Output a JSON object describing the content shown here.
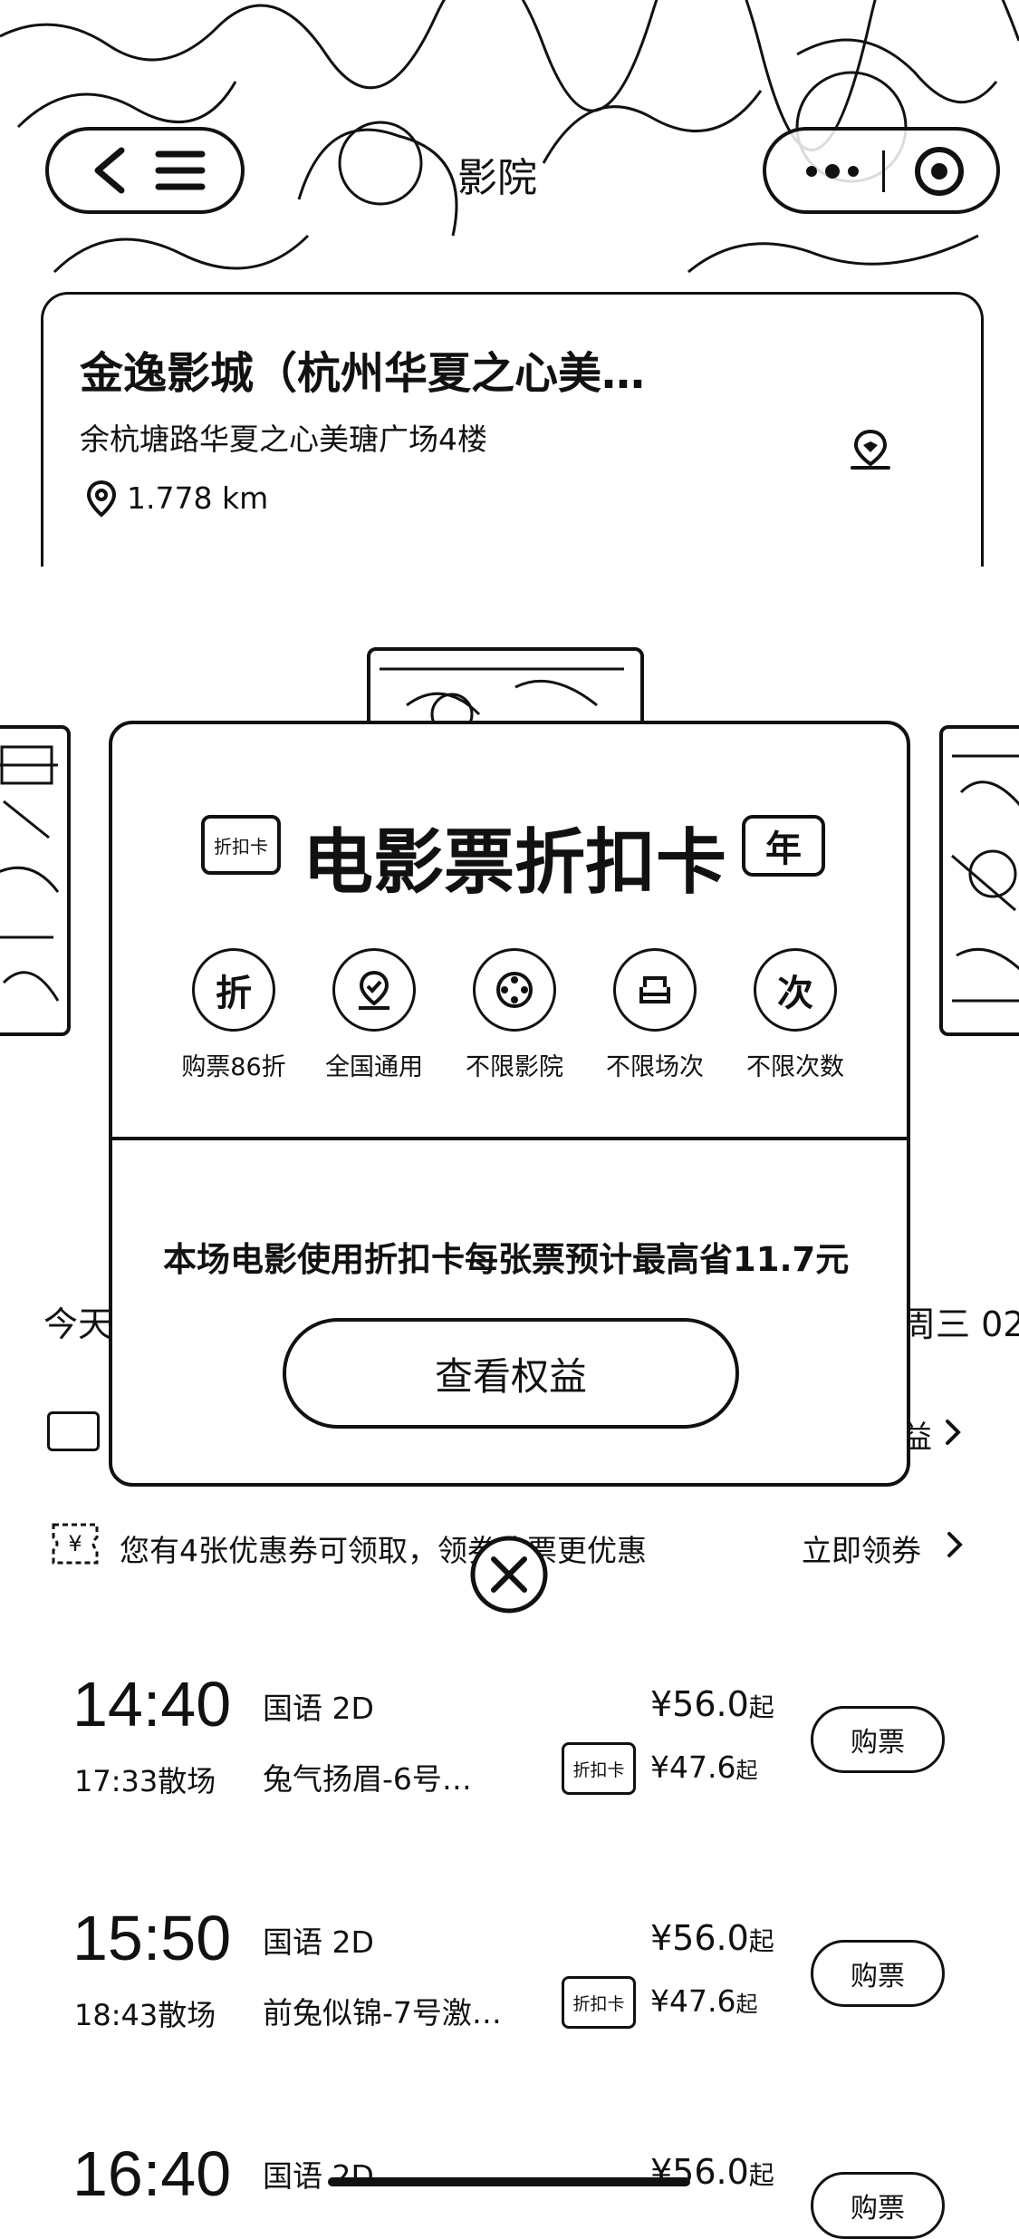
{
  "header": {
    "title": "影院"
  },
  "cinema": {
    "name": "金逸影城（杭州华夏之心美…",
    "address": "余杭塘路华夏之心美瑭广场4楼",
    "distance": "1.778 km"
  },
  "date_row": {
    "left_fragment": "今天",
    "right_fragment": "周三 02"
  },
  "card_row": {
    "right_fragment": "益"
  },
  "coupon": {
    "text": "您有4张优惠券可领取，领券购票更优惠",
    "action": "立即领券"
  },
  "modal": {
    "badge_left": "折扣卡",
    "title": "电影票折扣卡",
    "badge_right": "年",
    "benefits": [
      {
        "glyph": "折",
        "label": "购票86折"
      },
      {
        "glyph": "",
        "label": "全国通用"
      },
      {
        "glyph": "",
        "label": "不限影院"
      },
      {
        "glyph": "",
        "label": "不限场次"
      },
      {
        "glyph": "次",
        "label": "不限次数"
      }
    ],
    "saving": "本场电影使用折扣卡每张票预计最高省11.7元",
    "button": "查看权益"
  },
  "showtimes": [
    {
      "start": "14:40",
      "end": "17:33散场",
      "lang": "国语 2D",
      "hall": "兔气扬眉-6号…",
      "price": "¥56.0",
      "price_suffix": "起",
      "card_price": "¥47.6",
      "card_suffix": "起",
      "card_tag": "折扣卡",
      "buy": "购票"
    },
    {
      "start": "15:50",
      "end": "18:43散场",
      "lang": "国语 2D",
      "hall": "前兔似锦-7号激…",
      "price": "¥56.0",
      "price_suffix": "起",
      "card_price": "¥47.6",
      "card_suffix": "起",
      "card_tag": "折扣卡",
      "buy": "购票"
    },
    {
      "start": "16:40",
      "end": "",
      "lang": "国语 2D",
      "hall": "",
      "price": "¥56.0",
      "price_suffix": "起",
      "card_price": "",
      "card_suffix": "",
      "card_tag": "",
      "buy": "购票"
    }
  ]
}
